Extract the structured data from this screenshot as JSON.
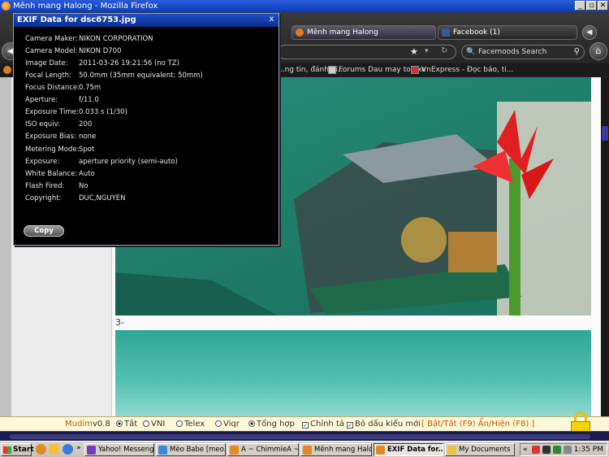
{
  "window": {
    "title": "Mênh mang Halong - Mozilla Firefox",
    "min_symbol": "_",
    "max_symbol": "▫",
    "close_symbol": "✕"
  },
  "tabs": [
    {
      "label": "Mênh mang Halong",
      "active": true
    },
    {
      "label": "Facebook (1)",
      "active": false
    }
  ],
  "search": {
    "placeholder": "Facemoods Search"
  },
  "bookmarks": [
    {
      "label": "...ng tin, đánh gi..."
    },
    {
      "label": "Forums Dau may toa xe"
    },
    {
      "label": "VnExpress - Đọc báo, ti..."
    }
  ],
  "page": {
    "caption": "3-"
  },
  "exif": {
    "title": "EXIF Data for dsc6753.jpg",
    "close_symbol": "x",
    "rows": [
      {
        "label": "Camera Maker:",
        "value": "NIKON CORPORATION"
      },
      {
        "label": "Camera Model:",
        "value": "NIKON D700"
      },
      {
        "label": "Image Date:",
        "value": "2011-03-26 19:21:56 (no TZ)"
      },
      {
        "label": "Focal Length:",
        "value": "50.0mm (35mm equivalent: 50mm)"
      },
      {
        "label": "Focus Distance:",
        "value": "0.75m"
      },
      {
        "label": "Aperture:",
        "value": "f/11.0"
      },
      {
        "label": "Exposure Time:",
        "value": "0.033 s (1/30)"
      },
      {
        "label": "ISO equiv:",
        "value": "200"
      },
      {
        "label": "Exposure Bias:",
        "value": "none"
      },
      {
        "label": "Metering Mode:",
        "value": "Spot"
      },
      {
        "label": "Exposure:",
        "value": "aperture priority (semi-auto)"
      },
      {
        "label": "White Balance:",
        "value": "Auto"
      },
      {
        "label": "Flash Fired:",
        "value": "No"
      },
      {
        "label": "Copyright:",
        "value": "DUC,NGUYEN"
      }
    ],
    "copy_label": "Copy"
  },
  "mudim": {
    "name": "Mudim",
    "version": "v0.8",
    "options": [
      {
        "label": "Tắt",
        "checked": true
      },
      {
        "label": "VNI",
        "checked": false
      },
      {
        "label": "Telex",
        "checked": false
      },
      {
        "label": "Viqr",
        "checked": false
      },
      {
        "label": "Tổng hợp",
        "checked": true
      }
    ],
    "check1": "Chính tả",
    "check2": "Bỏ dấu kiểu mới",
    "hotkeys": "[ Bật/Tắt (F9) Ẩn/Hiện (F8) ]",
    "accent_color": "#c05a00"
  },
  "taskbar": {
    "start_label": "Start",
    "tasks": [
      {
        "label": "Yahoo! Messenger",
        "active": false
      },
      {
        "label": "Mèo Babe [meo...",
        "active": false
      },
      {
        "label": "A ~ ChimmieA ~ ...",
        "active": false
      },
      {
        "label": "Mênh mang Halo...",
        "active": false
      },
      {
        "label": "EXIF Data for...",
        "active": true
      },
      {
        "label": "My Documents",
        "active": false
      }
    ],
    "tray_arrow": "«",
    "clock": "1:35 PM"
  }
}
